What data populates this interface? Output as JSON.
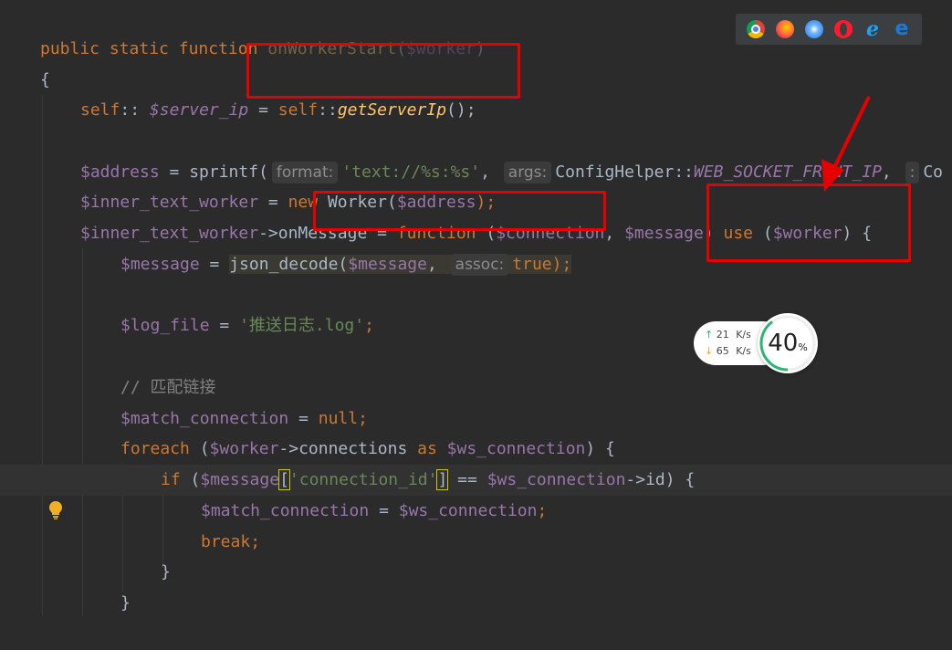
{
  "code": {
    "l1": {
      "public": "public",
      "static": "static",
      "function": "function",
      "name": "onWorkerStart",
      "open": "(",
      "param": "$worker",
      "close": ")"
    },
    "l2": {
      "brace": "{"
    },
    "l3": {
      "self": "self",
      "sep": "::",
      "prop": "$server_ip",
      "eq": " = ",
      "self2": "self",
      "sep2": "::",
      "method": "getServerIp",
      "rest": "();"
    },
    "l5": {
      "var": "$address",
      "eq": " = sprintf(",
      "hint_format": "format:",
      "str": "'text://%s:%s'",
      "comma": ",",
      "hint_args": "args:",
      "cls": "ConfigHelper",
      "sep": "::",
      "const": "WEB_SOCKET_FRONT_IP",
      "comma2": ",",
      "hint_more": ":",
      "tail": "Co"
    },
    "l6": {
      "var": "$inner_text_worker",
      "eq": " = ",
      "new": "new",
      "cls": "Worker(",
      "arg": "$address",
      "rest": ");"
    },
    "l7": {
      "var": "$inner_text_worker",
      "arrow": "->onMessage = ",
      "function": "function",
      "open": " (",
      "p1": "$connection",
      "comma": ", ",
      "p2": "$message",
      "close": ") ",
      "use": "use",
      "open2": " (",
      "p3": "$worker",
      "rest": ") {"
    },
    "l8": {
      "var": "$message",
      "eq": " = ",
      "fn": "json_decode(",
      "arg": "$message",
      "comma": ",",
      "hint_assoc": "assoc:",
      "val": "true",
      "rest": ");"
    },
    "l10": {
      "var": "$log_file",
      "eq": " = ",
      "str": "'推送日志.log'",
      "semi": ";"
    },
    "l12": {
      "comment": "// 匹配链接"
    },
    "l13": {
      "var": "$match_connection",
      "eq": " = ",
      "val": "null",
      "semi": ";"
    },
    "l14": {
      "kw": "foreach",
      "open": " (",
      "var": "$worker",
      "arrow": "->connections ",
      "as": "as",
      "var2": " $ws_connection",
      "rest": ") {"
    },
    "l15": {
      "kw": "if",
      "open": " (",
      "var": "$message",
      "lb": "[",
      "key": "'connection_id'",
      "rb": "]",
      "eq": " == ",
      "var2": "$ws_connection",
      "rest": "->id) {"
    },
    "l16": {
      "var": "$match_connection",
      "eq": " = ",
      "var2": "$ws_connection",
      "semi": ";"
    },
    "l17": {
      "kw": "break",
      "semi": ";"
    },
    "l18": {
      "brace": "}"
    },
    "l19": {
      "brace": "}"
    }
  },
  "browsers": [
    "chrome-icon",
    "firefox-icon",
    "safari-icon",
    "opera-icon",
    "ie-icon",
    "edge-icon"
  ],
  "net": {
    "up_value": "21",
    "up_unit": "K/s",
    "down_value": "65",
    "down_unit": "K/s",
    "percent": "40",
    "percent_sign": "%",
    "percent_fill": 0.4
  },
  "colors": {
    "background": "#2b2b2b",
    "keyword": "#cc7832",
    "function": "#ffc66d",
    "variable": "#9876aa",
    "string": "#6a8759",
    "annotation": "#e60000"
  }
}
